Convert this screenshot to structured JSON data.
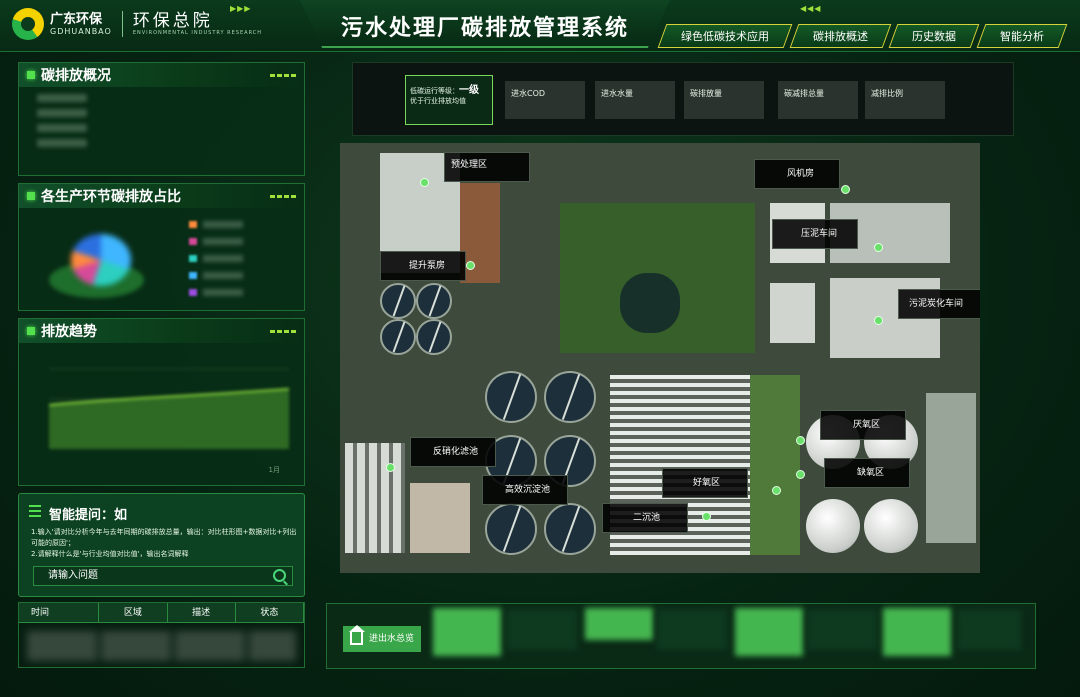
{
  "header": {
    "logo_cn": "广东环保",
    "logo_en": "GDHUANBAO",
    "brand_cn": "环保总院",
    "brand_en": "ENVIRONMENTAL INDUSTRY RESEARCH",
    "title": "污水处理厂碳排放管理系统",
    "nav": [
      "绿色低碳技术应用",
      "碳排放概述",
      "历史数据",
      "智能分析"
    ]
  },
  "panels": {
    "overview": {
      "title": "碳排放概况"
    },
    "share": {
      "title": "各生产环节碳排放占比"
    },
    "trend": {
      "title": "排放趋势",
      "x_hint": "1月"
    }
  },
  "ask": {
    "title": "智能提问：如",
    "tip1": "1.输入'请对比分析今年与去年同期的碳排放总量，输出：对比柱形图+数据对比+列出可能的原因'；",
    "tip2": "2.请解释什么是'与行业均值对比值'，输出名词解释",
    "placeholder": "请输入问题"
  },
  "table": {
    "columns": [
      "时间",
      "区域",
      "描述",
      "状态"
    ]
  },
  "metrics": {
    "level_label": "低碳运行等级：",
    "level_value": "一级",
    "level_note": "优于行业排放均值",
    "items": [
      "进水COD",
      "进水水量",
      "碳排放量",
      "碳减排总量",
      "减排比例"
    ]
  },
  "map_labels": {
    "pretreat": "预处理区",
    "blower": "风机房",
    "press": "压泥车间",
    "pump": "提升泵房",
    "carbon": "污泥炭化车间",
    "anaerobic": "厌氧区",
    "denitri": "反硝化滤池",
    "anoxic": "缺氧区",
    "aerobic": "好氧区",
    "hisettle": "高效沉淀池",
    "secondary": "二沉池"
  },
  "bottom": {
    "button": "进出水总览"
  },
  "colors": {
    "accent": "#53e04d",
    "nav_border": "#d7d23a",
    "panel_bg": "#082e16"
  }
}
